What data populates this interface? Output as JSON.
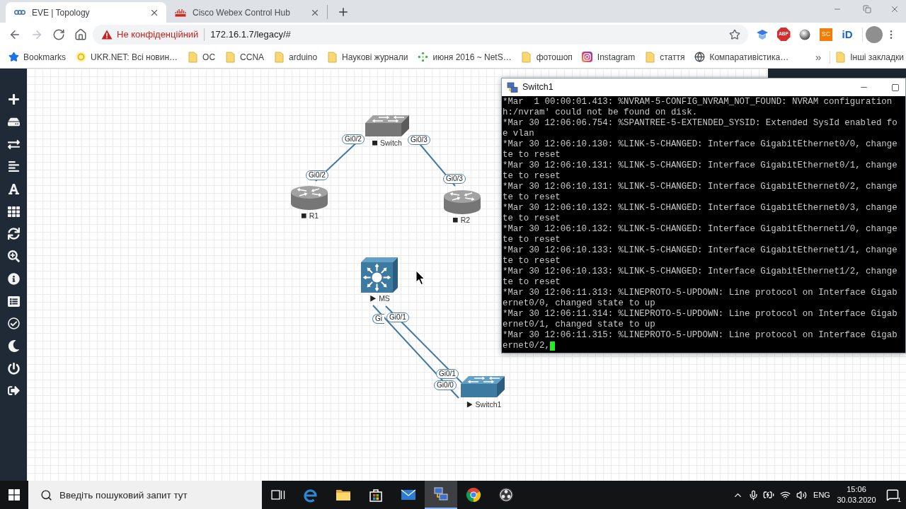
{
  "browser": {
    "tabs": [
      {
        "title": "EVE | Topology",
        "kind": "loops",
        "selected": true
      },
      {
        "title": "Cisco Webex Control Hub",
        "kind": "bars",
        "selected": false
      }
    ],
    "navigation": [
      {
        "kind": "back",
        "disabled": false
      },
      {
        "kind": "forward",
        "disabled": true
      },
      {
        "kind": "reload",
        "disabled": false
      },
      {
        "kind": "home",
        "disabled": false
      }
    ],
    "address_bar": {
      "security_warning": "Не конфіденційний",
      "url": "172.16.1.7/legacy/#"
    },
    "extensions": [
      {
        "kind": "cap"
      },
      {
        "kind": "stop-sign",
        "label": "ABP"
      },
      {
        "kind": "disc"
      },
      {
        "kind": "tile",
        "label": "SC"
      },
      {
        "kind": "wordmark",
        "label": "iD"
      }
    ],
    "bookmarks": [
      {
        "label": "Bookmarks",
        "kind": "star"
      },
      {
        "label": "UKR.NET: Всі новин…",
        "kind": "ring"
      },
      {
        "label": "ОС",
        "kind": "folder"
      },
      {
        "label": "CCNA",
        "kind": "folder"
      },
      {
        "label": "arduino",
        "kind": "folder"
      },
      {
        "label": "Наукові журнали",
        "kind": "folder"
      },
      {
        "label": "июня 2016 ~ NetS…",
        "kind": "dots"
      },
      {
        "label": "фотошоп",
        "kind": "folder"
      },
      {
        "label": "Instagram",
        "kind": "camera"
      },
      {
        "label": "стаття",
        "kind": "folder"
      },
      {
        "label": "Компаративістика…",
        "kind": "globe"
      }
    ],
    "more_bookmarks": "»",
    "other_bookmarks": {
      "label": "Інші закладки",
      "kind": "folder"
    }
  },
  "topology": {
    "nodes": [
      {
        "name": "Switch",
        "kind": "switch",
        "running": false
      },
      {
        "name": "R1",
        "kind": "router",
        "running": false
      },
      {
        "name": "R2",
        "kind": "router",
        "running": false
      },
      {
        "name": "MS",
        "kind": "multilayer-switch",
        "running": true
      },
      {
        "name": "Switch1",
        "kind": "switch",
        "running": true
      }
    ],
    "links": [
      {
        "labels": [
          "Gi0/2",
          "Gi0/2"
        ]
      },
      {
        "labels": [
          "Gi0/3",
          "Gi0/3"
        ]
      },
      {
        "labels": [
          "Gi",
          "Gi0/0"
        ]
      },
      {
        "labels": [
          "Gi0/1",
          "Gi0/1"
        ]
      }
    ]
  },
  "terminal": {
    "title": "Switch1",
    "lines": [
      "*Mar  1 00:00:01.413: %NVRAM-5-CONFIG_NVRAM_NOT_FOUND: NVRAM configuration",
      "h:/nvram' could not be found on disk.",
      "*Mar 30 12:06:06.754: %SPANTREE-5-EXTENDED_SYSID: Extended SysId enabled fo",
      "e vlan",
      "*Mar 30 12:06:10.130: %LINK-5-CHANGED: Interface GigabitEthernet0/0, change",
      "te to reset",
      "*Mar 30 12:06:10.131: %LINK-5-CHANGED: Interface GigabitEthernet0/1, change",
      "te to reset",
      "*Mar 30 12:06:10.131: %LINK-5-CHANGED: Interface GigabitEthernet0/2, change",
      "te to reset",
      "*Mar 30 12:06:10.132: %LINK-5-CHANGED: Interface GigabitEthernet0/3, change",
      "te to reset",
      "*Mar 30 12:06:10.132: %LINK-5-CHANGED: Interface GigabitEthernet1/0, change",
      "te to reset",
      "*Mar 30 12:06:10.133: %LINK-5-CHANGED: Interface GigabitEthernet1/1, change",
      "te to reset",
      "*Mar 30 12:06:10.133: %LINK-5-CHANGED: Interface GigabitEthernet1/2, change",
      "te to reset",
      "*Mar 30 12:06:11.313: %LINEPROTO-5-UPDOWN: Line protocol on Interface Gigab",
      "ernet0/0, changed state to up",
      "*Mar 30 12:06:11.314: %LINEPROTO-5-UPDOWN: Line protocol on Interface Gigab",
      "ernet0/1, changed state to up",
      "*Mar 30 12:06:11.315: %LINEPROTO-5-UPDOWN: Line protocol on Interface Gigab",
      "ernet0/2,"
    ]
  },
  "taskbar": {
    "search": {
      "placeholder": "Введіть пошуковий запит тут"
    },
    "apps": [
      {
        "kind": "task-view",
        "selected": false
      },
      {
        "kind": "swirl",
        "selected": false
      },
      {
        "kind": "folder",
        "selected": false
      },
      {
        "kind": "bag",
        "selected": false
      },
      {
        "kind": "mail",
        "selected": false
      },
      {
        "kind": "network",
        "selected": true
      },
      {
        "kind": "wheel",
        "selected": false
      },
      {
        "kind": "obs",
        "selected": false
      }
    ],
    "language": "ENG",
    "time": "15:06",
    "date": "30.03.2020",
    "notifications": "1"
  }
}
